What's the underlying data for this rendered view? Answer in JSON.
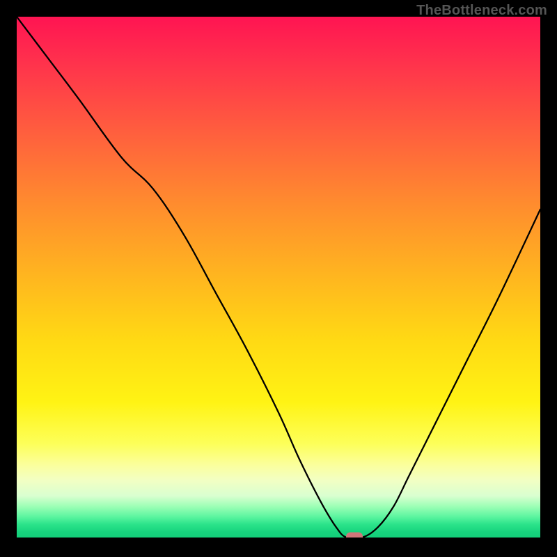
{
  "watermark": "TheBottleneck.com",
  "chart_data": {
    "type": "line",
    "title": "",
    "xlabel": "",
    "ylabel": "",
    "xlim": [
      0,
      100
    ],
    "ylim": [
      0,
      100
    ],
    "grid": false,
    "legend": false,
    "background": "vertical heatmap gradient (red high → green low)",
    "series": [
      {
        "name": "bottleneck-curve",
        "x": [
          0,
          6,
          12,
          20,
          26,
          32,
          38,
          44,
          50,
          54,
          58,
          61,
          63,
          66,
          69,
          72,
          75,
          80,
          86,
          92,
          100
        ],
        "y": [
          100,
          92,
          84,
          73,
          67,
          58,
          47,
          36,
          24,
          15,
          7,
          2,
          0,
          0,
          2,
          6,
          12,
          22,
          34,
          46,
          63
        ]
      }
    ],
    "annotations": [
      {
        "name": "optimal-marker",
        "x": 64.5,
        "y": 0,
        "shape": "rounded-bar",
        "color": "#d0767a"
      }
    ]
  }
}
